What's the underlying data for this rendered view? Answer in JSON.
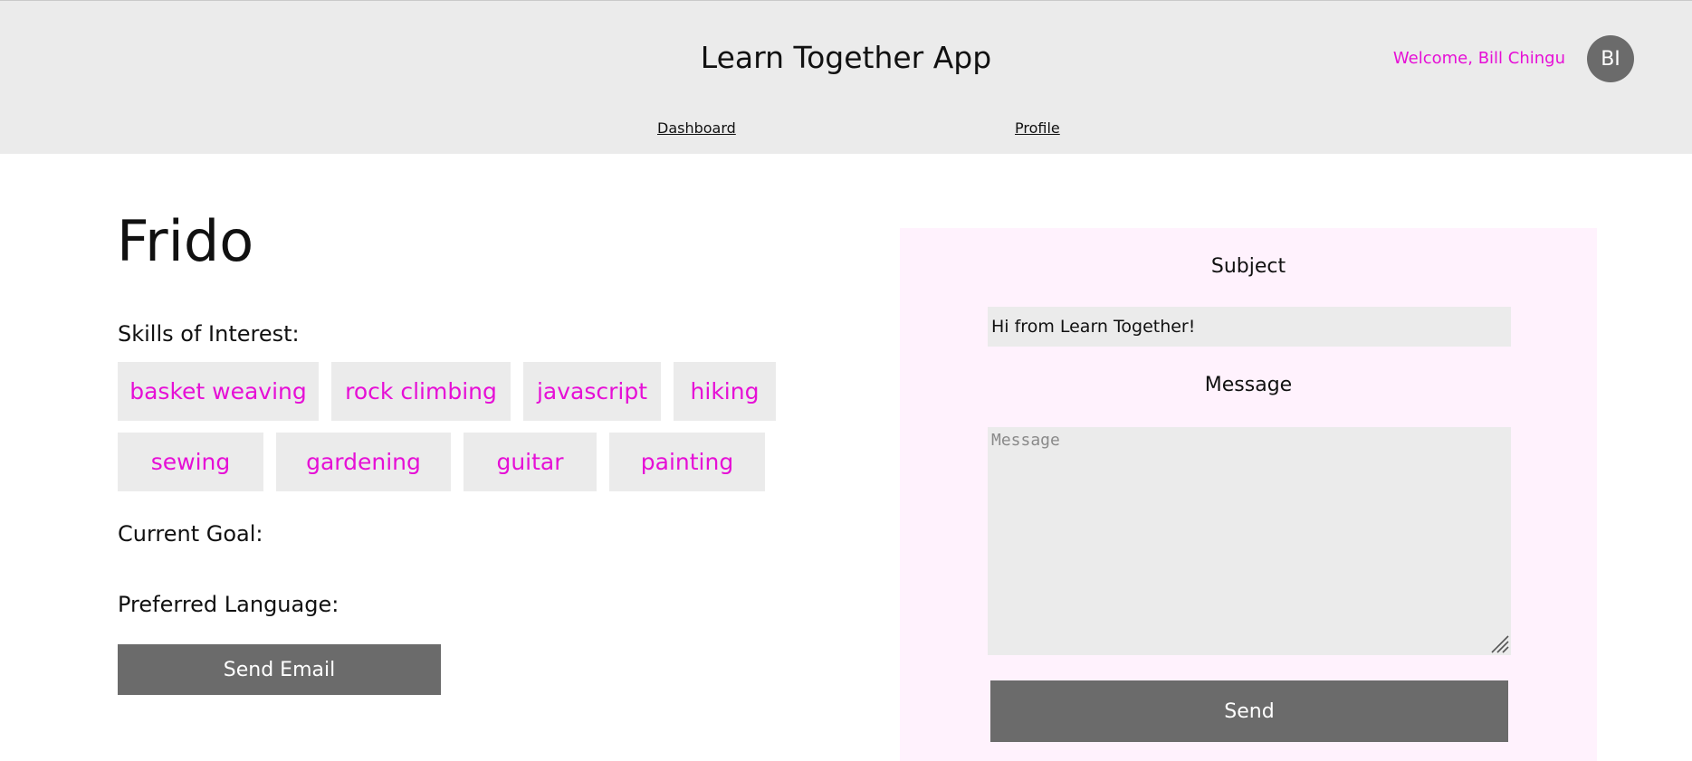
{
  "header": {
    "app_title": "Learn Together App",
    "welcome_text": "Welcome, Bill Chingu",
    "avatar_initials": "BI",
    "nav": {
      "dashboard": "Dashboard",
      "profile": "Profile"
    }
  },
  "profile": {
    "name": "Frido",
    "skills_label": "Skills of Interest:",
    "skills": [
      "basket weaving",
      "rock climbing",
      "javascript",
      "hiking",
      "sewing",
      "gardening",
      "guitar",
      "painting"
    ],
    "current_goal_label": "Current Goal:",
    "preferred_language_label": "Preferred Language:",
    "send_email_label": "Send Email"
  },
  "email_form": {
    "subject_label": "Subject",
    "subject_value": "Hi from Learn Together!",
    "message_label": "Message",
    "message_placeholder": "Message",
    "send_label": "Send"
  },
  "colors": {
    "accent": "#e60fd6",
    "header_bg": "#ebebeb",
    "button_bg": "#6b6b6b",
    "panel_bg": "#fff2fd"
  }
}
